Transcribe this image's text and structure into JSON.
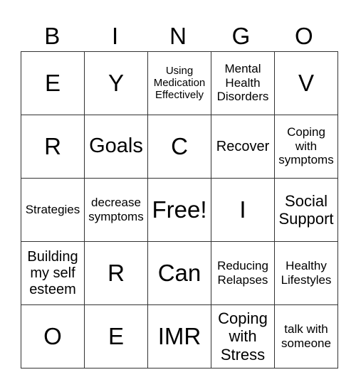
{
  "header": [
    "B",
    "I",
    "N",
    "G",
    "O"
  ],
  "rows": [
    [
      {
        "text": "E",
        "size": "s-xl"
      },
      {
        "text": "Y",
        "size": "s-xl"
      },
      {
        "text": "Using\nMedication\nEffectively",
        "size": "s-xs"
      },
      {
        "text": "Mental\nHealth\nDisorders",
        "size": "s-s"
      },
      {
        "text": "V",
        "size": "s-xl"
      }
    ],
    [
      {
        "text": "R",
        "size": "s-xl"
      },
      {
        "text": "Goals",
        "size": "s-l"
      },
      {
        "text": "C",
        "size": "s-xl"
      },
      {
        "text": "Recover",
        "size": "s-ms"
      },
      {
        "text": "Coping\nwith\nsymptoms",
        "size": "s-s"
      }
    ],
    [
      {
        "text": "Strategies",
        "size": "s-s"
      },
      {
        "text": "decrease\nsymptoms",
        "size": "s-s"
      },
      {
        "text": "Free!",
        "size": "s-xl"
      },
      {
        "text": "I",
        "size": "s-xl"
      },
      {
        "text": "Social\nSupport",
        "size": "s-m"
      }
    ],
    [
      {
        "text": "Building\nmy self\nesteem",
        "size": "s-ms"
      },
      {
        "text": "R",
        "size": "s-xl"
      },
      {
        "text": "Can",
        "size": "s-xl"
      },
      {
        "text": "Reducing\nRelapses",
        "size": "s-s"
      },
      {
        "text": "Healthy\nLifestyles",
        "size": "s-s"
      }
    ],
    [
      {
        "text": "O",
        "size": "s-xl"
      },
      {
        "text": "E",
        "size": "s-xl"
      },
      {
        "text": "IMR",
        "size": "s-xl"
      },
      {
        "text": "Coping\nwith\nStress",
        "size": "s-m"
      },
      {
        "text": "talk with\nsomeone",
        "size": "s-s"
      }
    ]
  ]
}
